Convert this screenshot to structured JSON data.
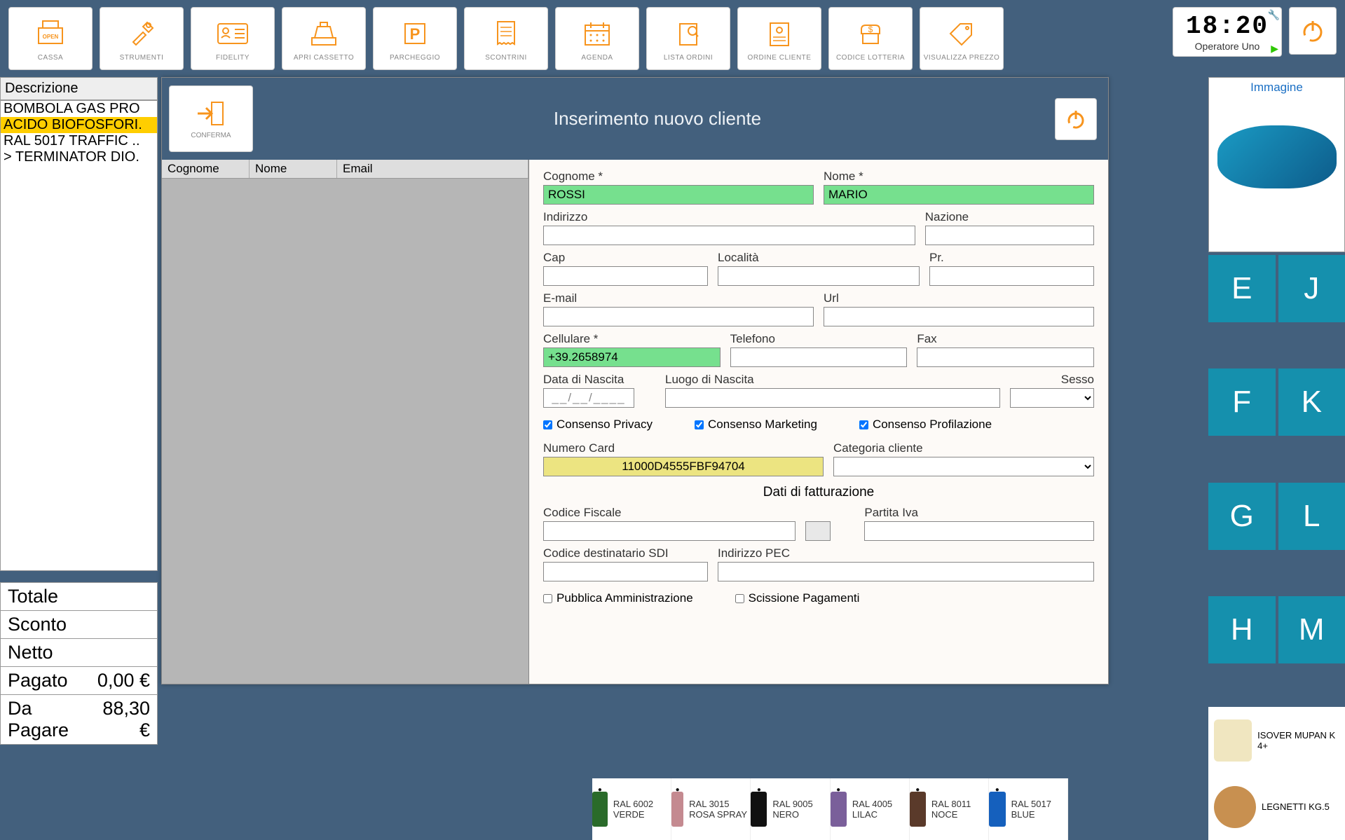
{
  "toolbar": {
    "buttons": [
      {
        "label": "CASSA"
      },
      {
        "label": "STRUMENTI"
      },
      {
        "label": "FIDELITY"
      },
      {
        "label": "APRI CASSETTO"
      },
      {
        "label": "PARCHEGGIO"
      },
      {
        "label": "SCONTRINI"
      },
      {
        "label": "AGENDA"
      },
      {
        "label": "LISTA ORDINI"
      },
      {
        "label": "ORDINE CLIENTE"
      },
      {
        "label": "CODICE LOTTERIA"
      },
      {
        "label": "VISUALIZZA PREZZO"
      }
    ],
    "clock_time": "18:20",
    "clock_operator": "Operatore Uno"
  },
  "left": {
    "desc_head": "Descrizione",
    "items": [
      "BOMBOLA GAS PRO",
      "ACIDO BIOFOSFORI.",
      "RAL 5017 TRAFFIC ..",
      "> TERMINATOR DIO."
    ]
  },
  "totals": {
    "rows": [
      {
        "label": "Totale",
        "value": ""
      },
      {
        "label": "Sconto",
        "value": ""
      },
      {
        "label": "Netto",
        "value": ""
      },
      {
        "label": "Pagato",
        "value": "0,00 €"
      },
      {
        "label": "Da Pagare",
        "value": "88,30 €"
      }
    ]
  },
  "modal": {
    "confirm_label": "CONFERMA",
    "title": "Inserimento nuovo cliente",
    "list_headers": [
      "Cognome",
      "Nome",
      "Email"
    ],
    "form": {
      "cognome_label": "Cognome *",
      "cognome": "ROSSI",
      "nome_label": "Nome *",
      "nome": "MARIO",
      "indirizzo_label": "Indirizzo",
      "nazione_label": "Nazione",
      "cap_label": "Cap",
      "localita_label": "Località",
      "pr_label": "Pr.",
      "email_label": "E-mail",
      "url_label": "Url",
      "cellulare_label": "Cellulare *",
      "cellulare": "+39.2658974",
      "telefono_label": "Telefono",
      "fax_label": "Fax",
      "datanascita_label": "Data di Nascita",
      "datanascita_placeholder": "__/__/____",
      "luogonascita_label": "Luogo di Nascita",
      "sesso_label": "Sesso",
      "consenso_privacy": "Consenso Privacy",
      "consenso_marketing": "Consenso Marketing",
      "consenso_profilazione": "Consenso Profilazione",
      "numerocard_label": "Numero Card",
      "numerocard": "11000D4555FBF94704",
      "categoria_label": "Categoria cliente",
      "section_billing": "Dati di fatturazione",
      "codfisc_label": "Codice Fiscale",
      "piva_label": "Partita Iva",
      "codsdi_label": "Codice destinatario SDI",
      "pec_label": "Indirizzo PEC",
      "pubamm": "Pubblica Amministrazione",
      "scissione": "Scissione Pagamenti"
    }
  },
  "right": {
    "image_title": "Immagine",
    "letters": [
      "E",
      "J",
      "F",
      "K",
      "G",
      "L",
      "H",
      "M"
    ],
    "side_prods": [
      "ISOVER MUPAN K 4+",
      "LEGNETTI KG.5"
    ]
  },
  "bottom": {
    "products": [
      {
        "name": "RAL 6002 VERDE",
        "color": "#2a6b2a"
      },
      {
        "name": "RAL 3015 ROSA SPRAY",
        "color": "#c48a90"
      },
      {
        "name": "RAL 9005 NERO",
        "color": "#111"
      },
      {
        "name": "RAL 4005 LILAC",
        "color": "#7a5f9a"
      },
      {
        "name": "RAL 8011 NOCE",
        "color": "#5a3a2a"
      },
      {
        "name": "RAL 5017 BLUE",
        "color": "#1560bd"
      }
    ]
  }
}
